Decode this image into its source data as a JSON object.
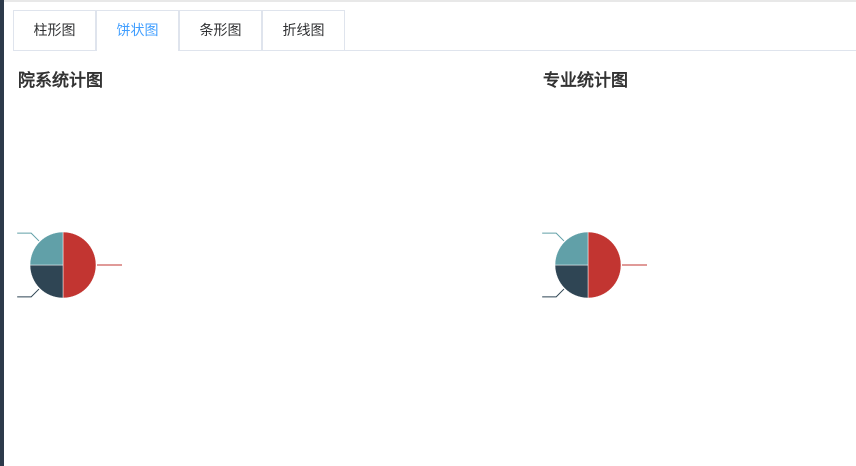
{
  "tabs": [
    {
      "label": "柱形图",
      "active": false
    },
    {
      "label": "饼状图",
      "active": true
    },
    {
      "label": "条形图",
      "active": false
    },
    {
      "label": "折线图",
      "active": false
    }
  ],
  "colors": {
    "accent": "#409eff",
    "series": [
      "#c23531",
      "#2f4554",
      "#61a0a8"
    ]
  },
  "chart_data": [
    {
      "type": "pie",
      "title": "院系统计图",
      "slices": [
        {
          "value": 50,
          "color": "#c23531"
        },
        {
          "value": 25,
          "color": "#2f4554"
        },
        {
          "value": 25,
          "color": "#61a0a8"
        }
      ]
    },
    {
      "type": "pie",
      "title": "专业统计图",
      "slices": [
        {
          "value": 50,
          "color": "#c23531"
        },
        {
          "value": 25,
          "color": "#2f4554"
        },
        {
          "value": 25,
          "color": "#61a0a8"
        }
      ]
    }
  ]
}
